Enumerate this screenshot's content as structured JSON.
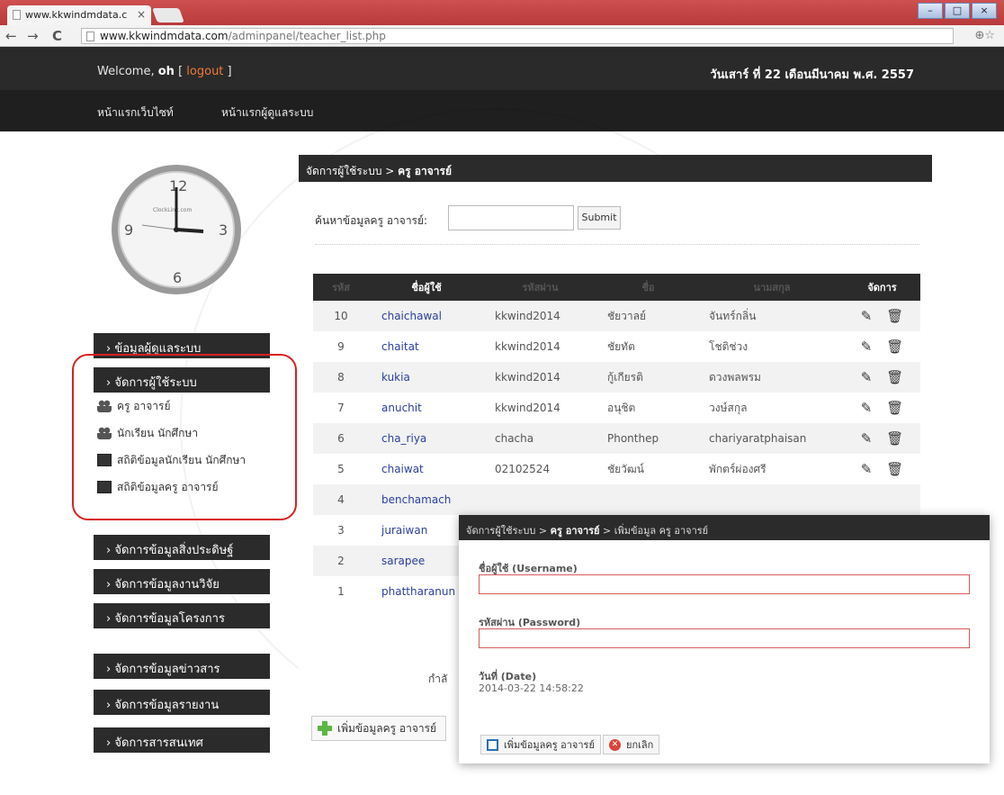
{
  "browser": {
    "tab_title": "www.kkwindmdata.c",
    "tab_close": "×",
    "url_host": "www.kkwindmdata.com",
    "url_path": "/adminpanel/teacher_list.php",
    "back": "←",
    "forward": "→",
    "reload": "C",
    "zoom_star": "⊕☆",
    "win_min": "–",
    "win_max": "□",
    "win_close": "×"
  },
  "header": {
    "welcome_prefix": "Welcome,",
    "user": "oh",
    "bracket_open": "[",
    "logout": "logout",
    "bracket_close": "]",
    "date": "วันเสาร์ ที่ 22 เดือนมีนาคม พ.ศ. 2557",
    "nav": [
      "หน้าแรกเว็บไซท์",
      "หน้าแรกผู้ดูแลระบบ"
    ]
  },
  "clock": {
    "brand": "ClockLink.com",
    "numbers": [
      "12",
      "3",
      "6",
      "9"
    ]
  },
  "sidebar": {
    "blocks": [
      "› ข้อมูลผู้ดูแลระบบ",
      "› จัดการผู้ใช้ระบบ",
      "› จัดการข้อมูลสิ่งประดิษฐ์",
      "› จัดการข้อมูลงานวิจัย",
      "› จัดการข้อมูลโครงการ",
      "› จัดการข้อมูลข่าวสาร",
      "› จัดการข้อมูลรายงาน",
      "› จัดการสารสนเทศ"
    ],
    "sub_items": [
      "ครู อาจารย์",
      "นักเรียน นักศึกษา",
      "สถิติข้อมูลนักเรียน นักศึกษา",
      "สถิติข้อมูลครู อาจารย์"
    ]
  },
  "main": {
    "breadcrumb_prefix": "จัดการผู้ใช้ระบบ >",
    "breadcrumb_current": "ครู อาจารย์",
    "search_label": "ค้นหาข้อมูลครู อาจารย์:",
    "search_value": "",
    "submit": "Submit",
    "columns": [
      "รหัส",
      "ชื่อผู้ใช้",
      "รหัสผ่าน",
      "ชื่อ",
      "นามสกุล",
      "จัดการ"
    ],
    "rows": [
      {
        "id": "10",
        "username": "chaichawal",
        "password": "kkwind2014",
        "first": "ชัยวาลย์",
        "last": "จันทร์กลิ่น"
      },
      {
        "id": "9",
        "username": "chaitat",
        "password": "kkwind2014",
        "first": "ชัยทัต",
        "last": "โชติช่วง"
      },
      {
        "id": "8",
        "username": "kukia",
        "password": "kkwind2014",
        "first": "กู้เกียรติ",
        "last": "ดวงพลพรม"
      },
      {
        "id": "7",
        "username": "anuchit",
        "password": "kkwind2014",
        "first": "อนุชิต",
        "last": "วงษ์สกุล"
      },
      {
        "id": "6",
        "username": "cha_riya",
        "password": "chacha",
        "first": "Phonthep",
        "last": "chariyaratphaisan"
      },
      {
        "id": "5",
        "username": "chaiwat",
        "password": "02102524",
        "first": "ชัยวัฒน์",
        "last": "พักตร์ผ่องศรี"
      },
      {
        "id": "4",
        "username": "benchamach",
        "password": "",
        "first": "",
        "last": ""
      },
      {
        "id": "3",
        "username": "juraiwan",
        "password": "",
        "first": "",
        "last": ""
      },
      {
        "id": "2",
        "username": "sarapee",
        "password": "",
        "first": "",
        "last": ""
      },
      {
        "id": "1",
        "username": "phattharanun",
        "password": "",
        "first": "",
        "last": ""
      }
    ],
    "edit_icon": "✎",
    "delete_icon": "🗑",
    "loading_text": "กำลั",
    "add_button": "เพิ่มข้อมูลครู อาจารย์"
  },
  "form": {
    "breadcrumb_prefix": "จัดการผู้ใช้ระบบ >",
    "breadcrumb_mid": "ครู อาจารย์",
    "breadcrumb_suffix": "> เพิ่มข้อมูล ครู อาจารย์",
    "username_label": "ชื่อผู้ใช้ (Username)",
    "username_value": "",
    "password_label": "รหัสผ่าน (Password)",
    "password_value": "",
    "date_label": "วันที่ (Date)",
    "date_value": "2014-03-22 14:58:22",
    "save_button": "เพิ่มข้อมูลครู อาจารย์",
    "cancel_button": "ยกเลิก",
    "cancel_icon": "✕"
  },
  "colors": {
    "header_bg": "#2a2a2a",
    "nav_bg": "#1f1f1f",
    "link": "#2a3da0",
    "logout": "#f07a3a",
    "highlight": "#d9201f"
  }
}
